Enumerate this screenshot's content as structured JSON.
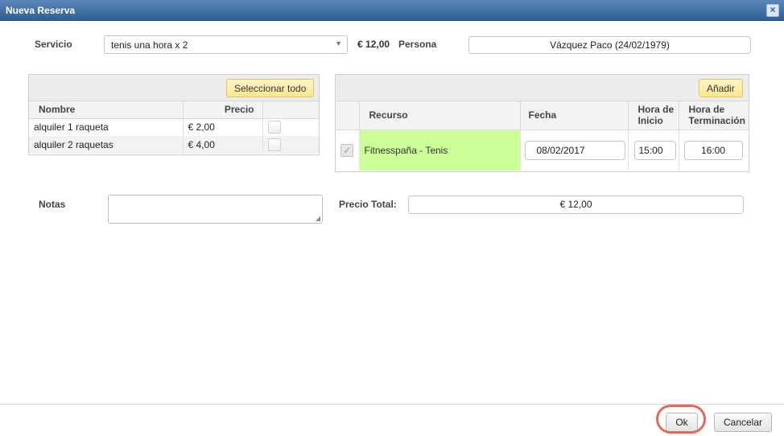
{
  "window": {
    "title": "Nueva Reserva",
    "close_icon": "×"
  },
  "form": {
    "servicio_label": "Servicio",
    "servicio_value": "tenis una hora x 2",
    "price": "€ 12,00",
    "persona_label": "Persona",
    "persona_value": "Vázquez Paco (24/02/1979)"
  },
  "extras": {
    "select_all_label": "Seleccionar todo",
    "columns": [
      "Nombre",
      "Precio"
    ],
    "rows": [
      {
        "name": "alquiler 1 raqueta",
        "price": "€ 2,00"
      },
      {
        "name": "alquiler 2 raquetas",
        "price": "€ 4,00"
      }
    ]
  },
  "resources": {
    "add_label": "Añadir",
    "columns": [
      "Recurso",
      "Fecha",
      "Hora de Inicio",
      "Hora de Terminación"
    ],
    "row": {
      "recurso": "Fitnesspaña - Tenis",
      "fecha": "08/02/2017",
      "inicio": "15:00",
      "fin": "16:00",
      "checked_icon": "✓"
    }
  },
  "notes": {
    "label": "Notas",
    "value": ""
  },
  "total": {
    "label": "Precio Total:",
    "value": "€ 12,00"
  },
  "footer": {
    "ok_label": "Ok",
    "cancel_label": "Cancelar"
  },
  "colors": {
    "title_bar": "#3f6fa3",
    "recurso_cell": "#ccff99",
    "highlight_ring": "#e06b5a",
    "accent_button": "#fbe78e"
  }
}
